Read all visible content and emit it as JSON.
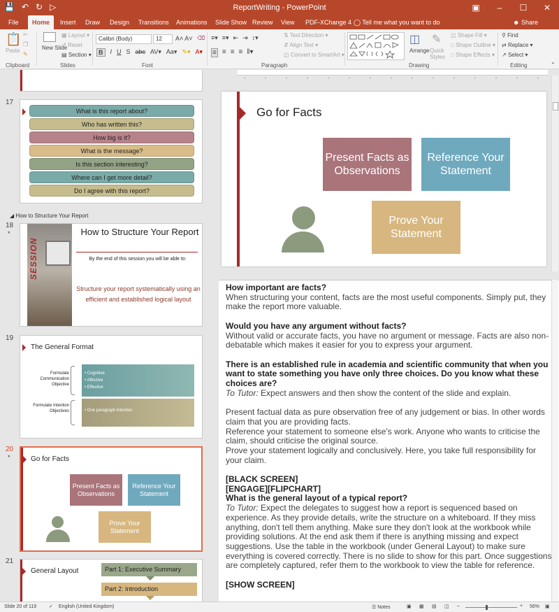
{
  "window": {
    "title": "ReportWriting - PowerPoint"
  },
  "ribbon_tabs": [
    "File",
    "Home",
    "Insert",
    "Draw",
    "Design",
    "Transitions",
    "Animations",
    "Slide Show",
    "Review",
    "View",
    "PDF-XChange 4"
  ],
  "tell_me": "Tell me what you want to do",
  "share": "Share",
  "ribbon": {
    "paste": "Paste",
    "new_slide": "New Slide",
    "layout": "Layout",
    "reset": "Reset",
    "section": "Section",
    "font_name": "Calibri (Body)",
    "font_size": "12",
    "text_direction": "Text Direction",
    "align_text": "Align Text",
    "convert_smartart": "Convert to SmartArt",
    "arrange": "Arrange",
    "quick_styles": "Quick Styles",
    "shape_fill": "Shape Fill",
    "shape_outline": "Shape Outline",
    "shape_effects": "Shape Effects",
    "find": "Find",
    "replace": "Replace",
    "select": "Select",
    "groups": {
      "clipboard": "Clipboard",
      "slides": "Slides",
      "font": "Font",
      "paragraph": "Paragraph",
      "drawing": "Drawing",
      "editing": "Editing"
    }
  },
  "slide17": {
    "number": "17",
    "items": [
      "What is this report about?",
      "Who has written this?",
      "How big is it?",
      "What is the message?",
      "Is this section interesting?",
      "Where can I get more detail?",
      "Do I agree with this report?"
    ]
  },
  "section_label": "How to Structure Your Report",
  "slide18": {
    "number": "18",
    "star": "*",
    "title": "How to Structure Your Report",
    "subtitle": "By the end of this session you will be able to:",
    "body": "Structure your report systematically using an efficient and established logical layout",
    "side": "SESSION"
  },
  "slide19": {
    "number": "19",
    "title": "The General Format",
    "label1": "Formulate Communication Objective",
    "bullets1": [
      "Cognitive",
      "Affective",
      "Effective"
    ],
    "label2": "Formulate Intention Objectives",
    "bullets2": [
      "One paragraph intention"
    ]
  },
  "slide20": {
    "number": "20",
    "star": "*",
    "title": "Go for Facts",
    "box1": "Present Facts as Observations",
    "box2": "Reference Your Statement",
    "box3": "Prove Your Statement"
  },
  "slide21": {
    "number": "21",
    "title": "General Layout",
    "parts": [
      "Part 1: Executive Summary",
      "Part 2: Introduction"
    ]
  },
  "notes": [
    {
      "t": "How important are facts?",
      "s": "b"
    },
    {
      "t": "When structuring your content, facts are the most useful components. Simply put, they make the report more valuable.",
      "s": ""
    },
    {
      "t": "",
      "s": "gap"
    },
    {
      "t": "Would you have any argument without facts?",
      "s": "b"
    },
    {
      "t": "Without valid or accurate facts, you have no argument or message. Facts are also non-debatable which makes it easier for you to express your argument.",
      "s": ""
    },
    {
      "t": "",
      "s": "gap"
    },
    {
      "t": "There is an established rule in academia and scientific community that when you want to state something you have only three choices. Do you know what these choices are?",
      "s": "b"
    },
    {
      "t": "To Tutor:",
      "s": "i",
      "rest": " Expect answers and then show the content of the slide and explain."
    },
    {
      "t": "",
      "s": "gap"
    },
    {
      "t": "Present factual data as pure observation free of any judgement or bias. In other words claim that you are providing facts.",
      "s": ""
    },
    {
      "t": "Reference your statement to someone else's work. Anyone who wants to criticise the claim, should criticise the original source.",
      "s": ""
    },
    {
      "t": "Prove your statement logically and conclusively. Here, you take full responsibility for your claim.",
      "s": ""
    },
    {
      "t": "",
      "s": "gap"
    },
    {
      "t": "[BLACK SCREEN]",
      "s": "b"
    },
    {
      "t": "[ENGAGE][FLIPCHART]",
      "s": "b"
    },
    {
      "t": "What is the general layout of a typical report?",
      "s": "b"
    },
    {
      "t": "To Tutor:",
      "s": "i",
      "rest": " Expect the delegates to suggest how a report is sequenced based on experience. As they provide details, write the structure on a whiteboard. If they miss anything, don't tell them anything. Make sure they don't look at the workbook while providing solutions. At the end ask them if there is anything missing and expect suggestions. Use the table in the workbook (under General Layout) to make sure everything is covered correctly. There is no slide to show for this part. Once suggestions are completely captured, refer them to the workbook to view the table for reference."
    },
    {
      "t": "",
      "s": "gap"
    },
    {
      "t": "[SHOW SCREEN]",
      "s": "b"
    }
  ],
  "status": {
    "slide_count": "Slide 20 of 119",
    "language": "English (United Kingdom)",
    "notes": "Notes",
    "zoom": "56%"
  },
  "colors": {
    "accent": "#b7472a",
    "rose": "#a9747a",
    "teal": "#6fa9bd",
    "sand": "#d7b77f",
    "sage": "#8c9a7e"
  }
}
